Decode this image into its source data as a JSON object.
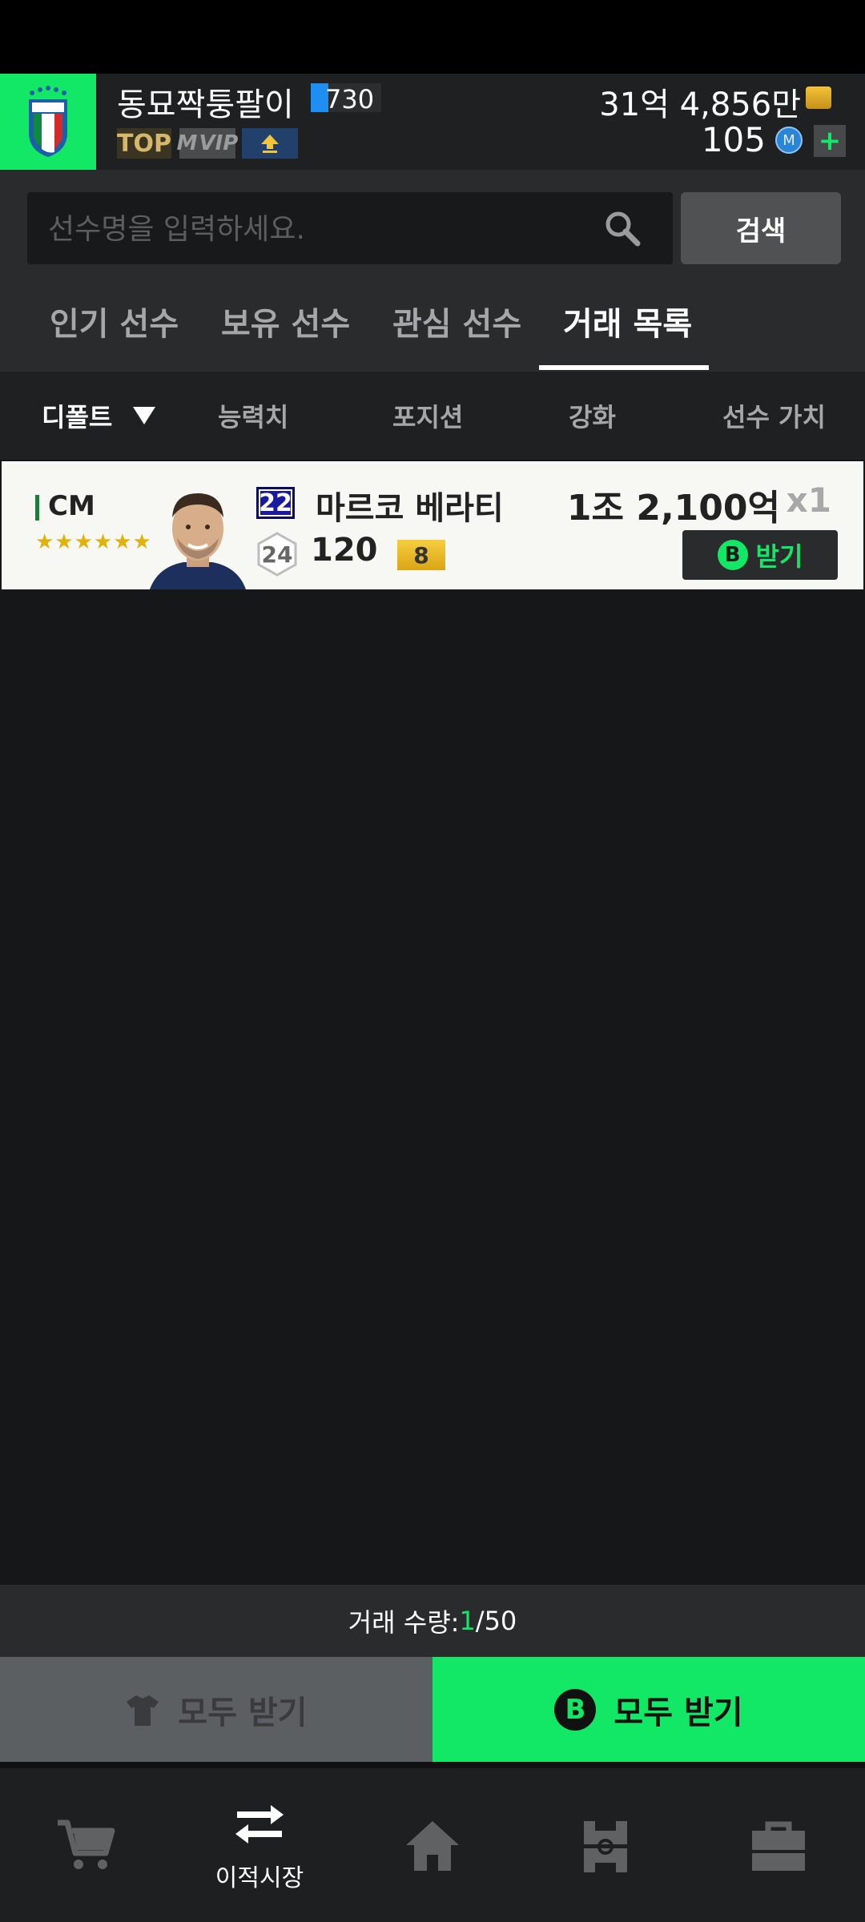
{
  "header": {
    "username": "동묘짝퉁팔이",
    "level": "730",
    "tags": {
      "top": "TOP",
      "vip": "VIP"
    },
    "money": "31억 4,856만",
    "mc_value": "105",
    "mc_icon_label": "M",
    "plus_label": "+"
  },
  "search": {
    "placeholder": "선수명을 입력하세요.",
    "button_label": "검색"
  },
  "tabs": [
    {
      "label": "인기 선수"
    },
    {
      "label": "보유 선수"
    },
    {
      "label": "관심 선수"
    },
    {
      "label": "거래 목록",
      "active": true
    }
  ],
  "sort": {
    "items": [
      "디폴트",
      "능력치",
      "포지션",
      "강화",
      "선수 가치"
    ],
    "selected": "디폴트"
  },
  "list": [
    {
      "position": "CM",
      "stars": "★★★★★★",
      "season": "22",
      "name": "마르코 베라티",
      "salary": "24",
      "ovr": "120",
      "grade": "8",
      "price": "1조 2,100억",
      "qty": "x1",
      "button_icon": "B",
      "button_label": "받기"
    }
  ],
  "trade_count": {
    "label": "거래 수량: ",
    "current": "1",
    "max": "/50"
  },
  "actions": {
    "receive_all_gray": "모두 받기",
    "receive_all_green": "모두 받기",
    "b_icon": "B"
  },
  "nav": {
    "items": [
      {
        "icon": "cart-icon",
        "label": ""
      },
      {
        "icon": "transfer-icon",
        "label": "이적시장",
        "active": true
      },
      {
        "icon": "home-icon",
        "label": ""
      },
      {
        "icon": "field-icon",
        "label": ""
      },
      {
        "icon": "shop-icon",
        "label": ""
      }
    ]
  },
  "colors": {
    "accent": "#13e866",
    "header_bg": "#1f2021",
    "card_bg": "#f7f7f4",
    "season_badge": "#1a1aa0",
    "grade_gold": "#e2b20c"
  }
}
